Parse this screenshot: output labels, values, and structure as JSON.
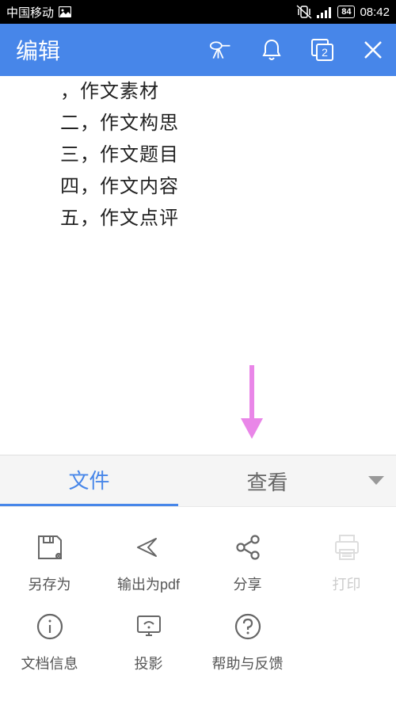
{
  "statusBar": {
    "carrier": "中国移动",
    "battery": "84",
    "time": "08:42"
  },
  "topBar": {
    "title": "编辑",
    "windowCount": "2"
  },
  "content": {
    "lines": [
      "，作文素材",
      "二，作文构思",
      "三，作文题目",
      "四，作文内容",
      "五，作文点评"
    ]
  },
  "tabs": {
    "file": "文件",
    "view": "查看"
  },
  "actions": {
    "saveAs": "另存为",
    "exportPdf": "输出为pdf",
    "share": "分享",
    "print": "打印",
    "docInfo": "文档信息",
    "projection": "投影",
    "helpFeedback": "帮助与反馈"
  }
}
